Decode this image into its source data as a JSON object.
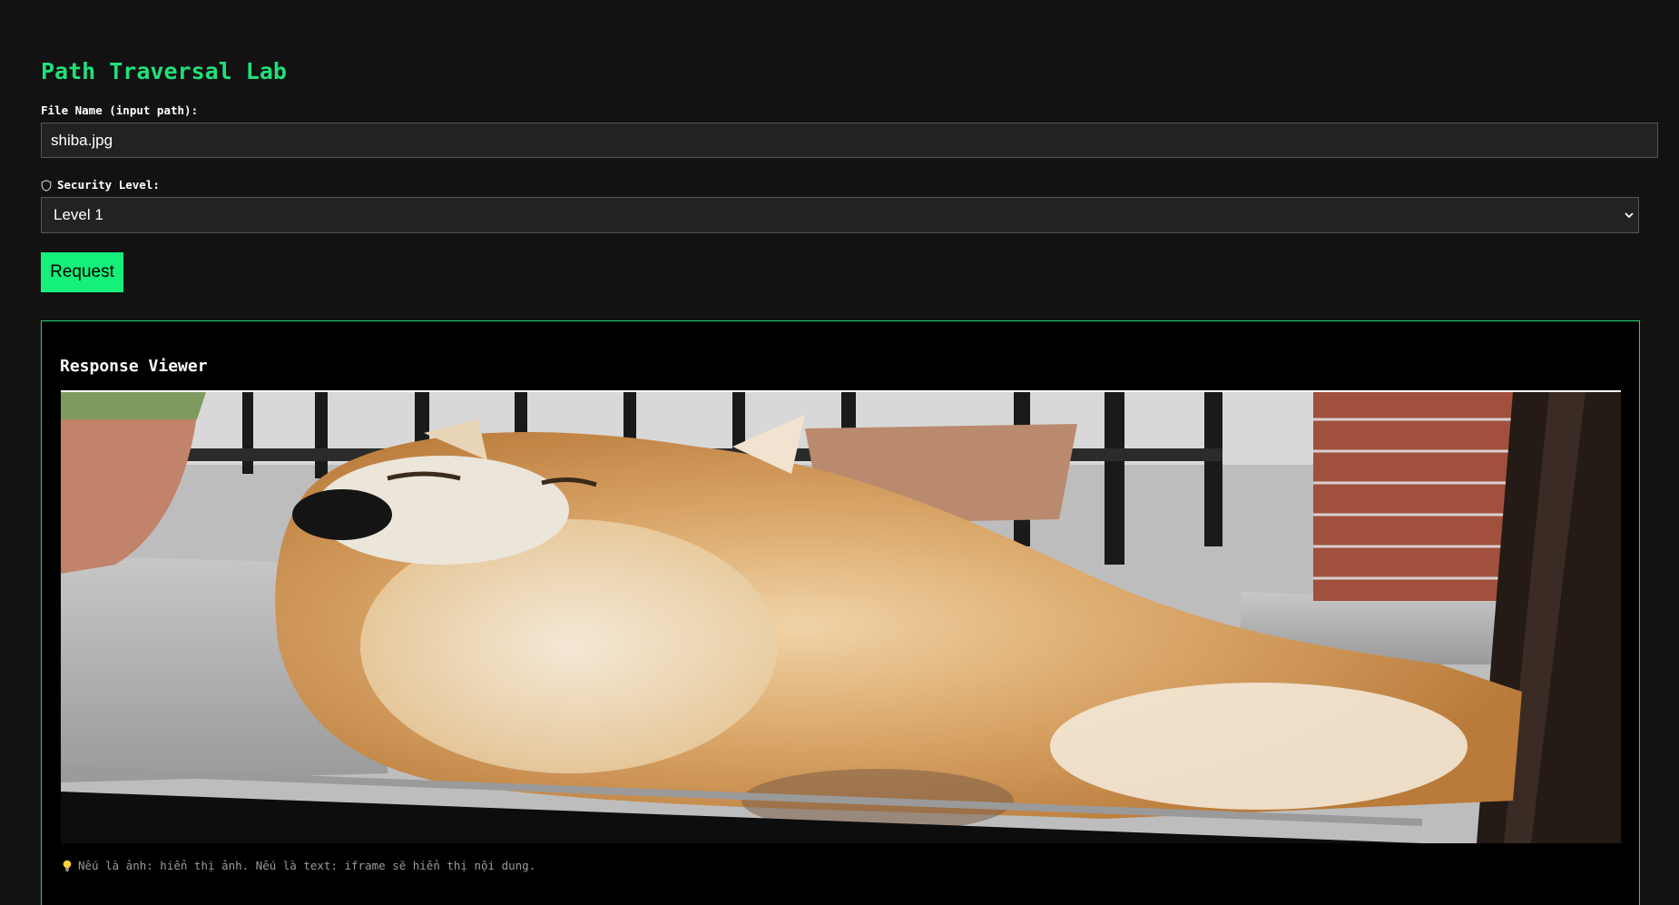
{
  "page": {
    "title": "Path Traversal Lab"
  },
  "file_input": {
    "label": "File Name (input path):",
    "value": "shiba.jpg"
  },
  "security": {
    "label": "Security Level:",
    "icon": "shield-icon",
    "selected": "Level 1"
  },
  "request_button": {
    "label": "Request"
  },
  "viewer": {
    "title": "Response Viewer",
    "image_subject": "shiba inu dog",
    "note_icon": "lightbulb-icon",
    "note": "Nếu là ảnh: hiển thị ảnh. Nếu là text: iframe sẽ hiển thị nội dung."
  },
  "colors": {
    "background": "#121212",
    "accent": "#14f07a",
    "title": "#21e07a",
    "panel": "#000000",
    "field": "#222222"
  }
}
